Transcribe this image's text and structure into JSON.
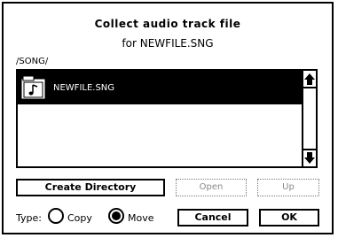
{
  "dialog": {
    "title": "Collect audio track file",
    "subtitle": "for NEWFILE.SNG",
    "path": "/SONG/"
  },
  "file_list": {
    "items": [
      {
        "name": "NEWFILE.SNG",
        "icon": "song-folder-icon",
        "selected": true
      }
    ]
  },
  "buttons": {
    "create_directory": "Create Directory",
    "open": "Open",
    "up": "Up",
    "cancel": "Cancel",
    "ok": "OK"
  },
  "type": {
    "label": "Type:",
    "options": [
      {
        "label": "Copy",
        "selected": false
      },
      {
        "label": "Move",
        "selected": true
      }
    ]
  }
}
